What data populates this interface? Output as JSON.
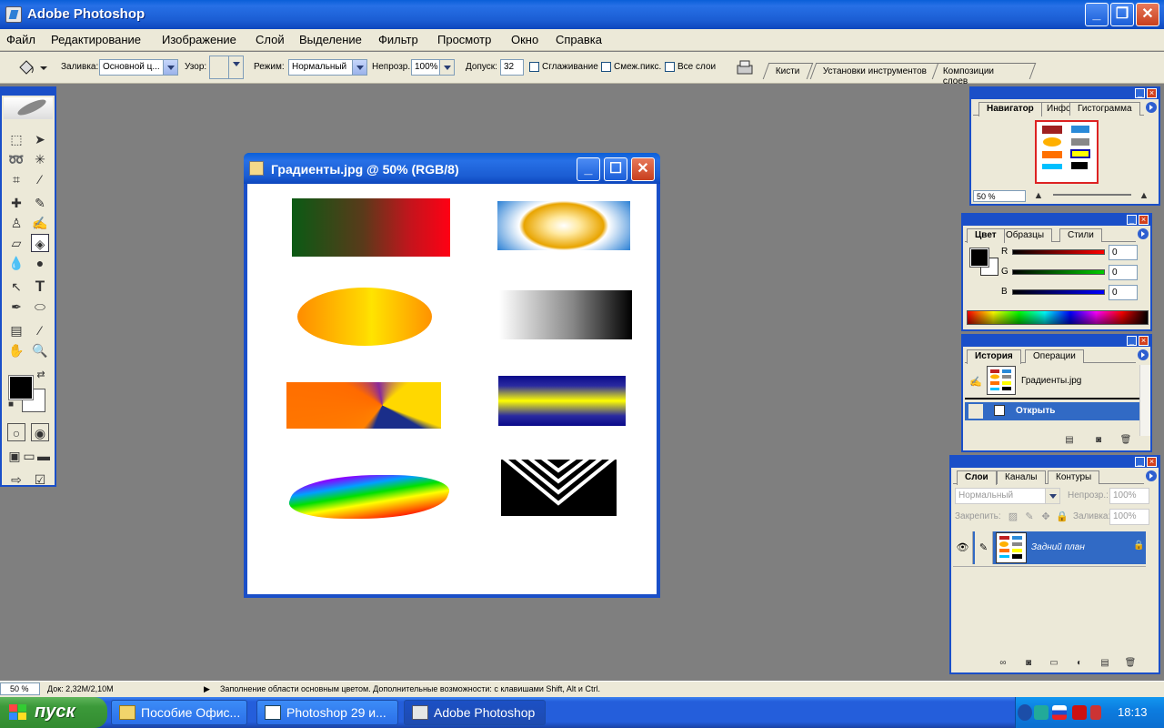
{
  "window": {
    "title": "Adobe Photoshop"
  },
  "menu": [
    "Файл",
    "Редактирование",
    "Изображение",
    "Слой",
    "Выделение",
    "Фильтр",
    "Просмотр",
    "Окно",
    "Справка"
  ],
  "options": {
    "fill_label": "Заливка:",
    "fill_value": "Основной ц...",
    "pattern_label": "Узор:",
    "mode_label": "Режим:",
    "mode_value": "Нормальный",
    "opacity_label": "Непрозр.:",
    "opacity_value": "100%",
    "tolerance_label": "Допуск:",
    "tolerance_value": "32",
    "antialias_label": "Сглаживание",
    "contiguous_label": "Смеж.пикс.",
    "all_layers_label": "Все слои"
  },
  "palette_well": {
    "tabs": [
      "Кисти",
      "Установки инструментов",
      "Композиции слоев"
    ]
  },
  "document": {
    "title": "Градиенты.jpg @ 50% (RGB/8)"
  },
  "navigator": {
    "tabs": [
      "Навигатор",
      "Инфо",
      "Гистограмма"
    ],
    "zoom": "50 %"
  },
  "color_panel": {
    "tabs": [
      "Цвет",
      "Образцы",
      "Стили"
    ],
    "channels": [
      {
        "label": "R",
        "value": "0",
        "color": "#ff0000"
      },
      {
        "label": "G",
        "value": "0",
        "color": "#00cc00"
      },
      {
        "label": "B",
        "value": "0",
        "color": "#0000ff"
      }
    ]
  },
  "history": {
    "tabs": [
      "История",
      "Операции"
    ],
    "snapshot": "Градиенты.jpg",
    "items": [
      "Открыть"
    ]
  },
  "layers": {
    "tabs": [
      "Слои",
      "Каналы",
      "Контуры"
    ],
    "blend_mode": "Нормальный",
    "opacity_label": "Непрозр.:",
    "opacity_value": "100%",
    "lock_label": "Закрепить:",
    "fill_label": "Заливка:",
    "fill_value": "100%",
    "layer_name": "Задний план"
  },
  "status": {
    "zoom": "50 %",
    "doc": "Док: 2,32M/2,10M",
    "hint": "Заполнение области основным цветом. Дополнительные возможности: с клавишами Shift, Alt и Ctrl."
  },
  "taskbar": {
    "start": "пуск",
    "tasks": [
      "Пособие Офис...",
      "Photoshop 29 и...",
      "Adobe Photoshop"
    ],
    "clock": "18:13"
  },
  "colors": {
    "xp_blue": "#1a4fc8",
    "panel_bg": "#ece9d8",
    "workspace": "#7f7f7f"
  }
}
